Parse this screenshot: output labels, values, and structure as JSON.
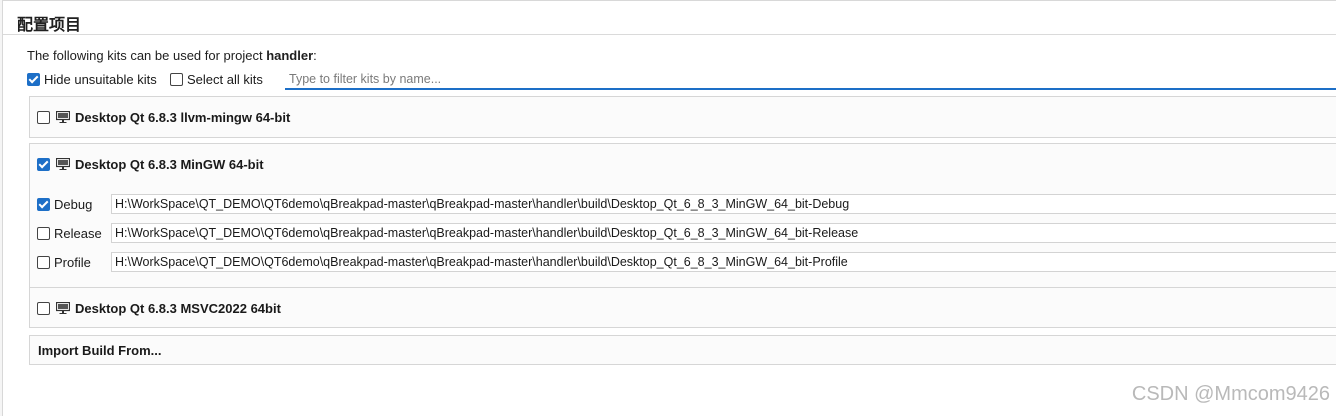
{
  "page": {
    "title": "配置项目",
    "intro_prefix": "The following kits can be used for project ",
    "project_name": "handler",
    "intro_suffix": ":"
  },
  "options": {
    "hide_unsuitable": {
      "label": "Hide unsuitable kits",
      "checked": true
    },
    "select_all": {
      "label": "Select all kits",
      "checked": false
    }
  },
  "filter": {
    "placeholder": "Type to filter kits by name...",
    "value": ""
  },
  "kits": [
    {
      "name": "Desktop Qt 6.8.3 llvm-mingw 64-bit",
      "checked": false,
      "icon": "monitor-icon"
    },
    {
      "name": "Desktop Qt 6.8.3 MinGW 64-bit",
      "checked": true,
      "icon": "monitor-icon",
      "builds": [
        {
          "label": "Debug",
          "checked": true,
          "path": "H:\\WorkSpace\\QT_DEMO\\QT6demo\\qBreakpad-master\\qBreakpad-master\\handler\\build\\Desktop_Qt_6_8_3_MinGW_64_bit-Debug"
        },
        {
          "label": "Release",
          "checked": false,
          "path": "H:\\WorkSpace\\QT_DEMO\\QT6demo\\qBreakpad-master\\qBreakpad-master\\handler\\build\\Desktop_Qt_6_8_3_MinGW_64_bit-Release"
        },
        {
          "label": "Profile",
          "checked": false,
          "path": "H:\\WorkSpace\\QT_DEMO\\QT6demo\\qBreakpad-master\\qBreakpad-master\\handler\\build\\Desktop_Qt_6_8_3_MinGW_64_bit-Profile"
        }
      ]
    },
    {
      "name": "Desktop Qt 6.8.3 MSVC2022 64bit",
      "checked": false,
      "icon": "monitor-icon"
    }
  ],
  "import_label": "Import Build From...",
  "watermark": "CSDN @Mmcom9426",
  "colors": {
    "accent": "#1d6fc7",
    "border": "#d6d6d6",
    "panel_bg": "#fbfbfb"
  }
}
